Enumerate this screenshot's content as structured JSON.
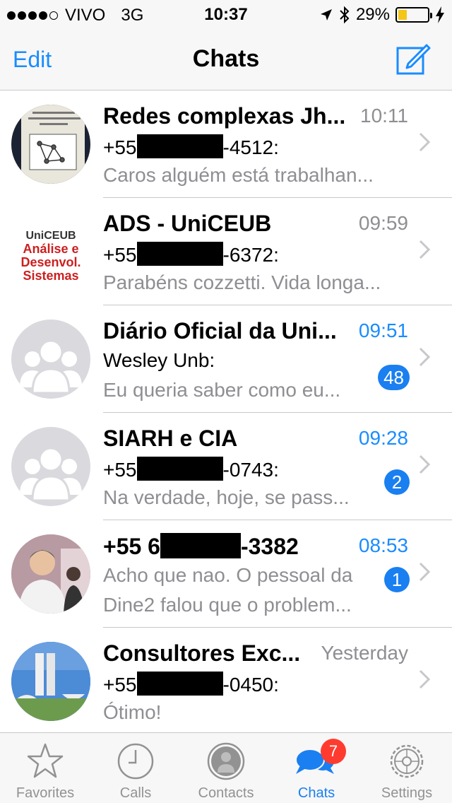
{
  "status_bar": {
    "carrier": "VIVO",
    "network": "3G",
    "time": "10:37",
    "battery_percent": "29%",
    "battery_level": 0.29,
    "signal_dots_filled": 4,
    "signal_dots_total": 5
  },
  "nav": {
    "edit_label": "Edit",
    "title": "Chats",
    "compose_icon": "compose-icon"
  },
  "chats": [
    {
      "name": "Redes complexas Jh...",
      "time": "10:11",
      "time_unread": false,
      "sender_prefix": "+55",
      "sender_suffix": "-4512:",
      "preview": "Caros alguém está trabalhan...",
      "badge": "",
      "avatar": "book-cover"
    },
    {
      "name": "ADS - UniCEUB",
      "time": "09:59",
      "time_unread": false,
      "sender_prefix": "+55",
      "sender_suffix": "-6372:",
      "preview": "Parabéns cozzetti. Vida longa...",
      "badge": "",
      "avatar": "uniceub-logo",
      "avatar_text": {
        "line1": "UniCEUB",
        "line2": "Análise e",
        "line3": "Desenvol.",
        "line4": "Sistemas"
      }
    },
    {
      "name": "Diário Oficial da Uni...",
      "time": "09:51",
      "time_unread": true,
      "sender": "Wesley Unb:",
      "preview": "Eu queria saber como eu...",
      "badge": "48",
      "avatar": "group-placeholder"
    },
    {
      "name": "SIARH e CIA",
      "time": "09:28",
      "time_unread": true,
      "sender_prefix": "+55",
      "sender_suffix": "-0743:",
      "preview": "Na verdade, hoje, se pass...",
      "badge": "2",
      "avatar": "group-placeholder"
    },
    {
      "name_prefix": "+55 6",
      "name_suffix": "-3382",
      "time": "08:53",
      "time_unread": true,
      "preview_line1": "Acho que nao. O pessoal da",
      "preview_line2": "Dine2 falou que o problem...",
      "badge": "1",
      "avatar": "person-photo"
    },
    {
      "name": "Consultores Exc...",
      "time": "Yesterday",
      "time_unread": false,
      "sender_prefix": "+55",
      "sender_suffix": "-0450:",
      "preview": "Ótimo!",
      "badge": "",
      "avatar": "congress-photo"
    }
  ],
  "tabs": [
    {
      "label": "Favorites",
      "icon": "star-icon",
      "active": false
    },
    {
      "label": "Calls",
      "icon": "clock-icon",
      "active": false
    },
    {
      "label": "Contacts",
      "icon": "contact-icon",
      "active": false
    },
    {
      "label": "Chats",
      "icon": "chat-bubbles-icon",
      "active": true,
      "badge": "7"
    },
    {
      "label": "Settings",
      "icon": "gear-icon",
      "active": false
    }
  ],
  "colors": {
    "accent": "#1a8cff",
    "badge_blue": "#1a7ff0",
    "badge_red": "#ff3b30",
    "secondary_text": "#8e8e93",
    "battery_fill": "#f5c518"
  }
}
